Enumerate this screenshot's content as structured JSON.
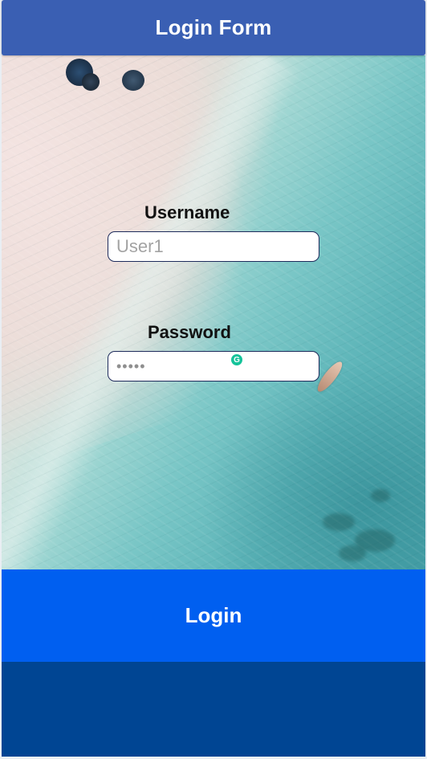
{
  "header": {
    "title": "Login Form"
  },
  "form": {
    "username_label": "Username",
    "username_placeholder": "User1",
    "password_label": "Password",
    "password_masked": "•••••"
  },
  "login_button": {
    "label": "Login"
  },
  "icons": {
    "grammarly": "grammarly-icon",
    "grammarly_glyph": "G"
  },
  "colors": {
    "header": "#3a5fb3",
    "login_button": "#005ff0",
    "footer": "#004593",
    "field_border": "#1f2c5c"
  }
}
